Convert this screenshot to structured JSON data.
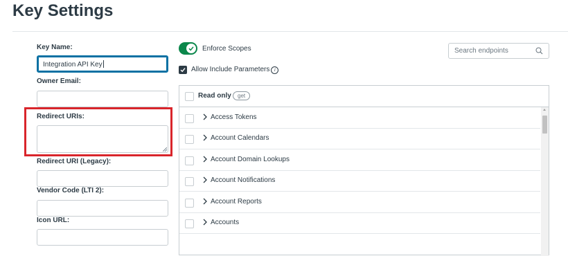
{
  "page_title": "Key Settings",
  "form": {
    "key_name_label": "Key Name:",
    "key_name_value": "Integration API Key",
    "owner_email_label": "Owner Email:",
    "owner_email_value": "",
    "redirect_uris_label": "Redirect URIs:",
    "redirect_uris_value": "",
    "redirect_uri_legacy_label": "Redirect URI (Legacy):",
    "vendor_code_label": "Vendor Code (LTI 2):",
    "icon_url_label": "Icon URL:"
  },
  "scopes": {
    "enforce_label": "Enforce Scopes",
    "enforce_on": true,
    "allow_include_label": "Allow Include Parameters",
    "allow_include_checked": true,
    "search_placeholder": "Search endpoints",
    "read_only_label": "Read only",
    "get_pill": "get",
    "items": [
      {
        "label": "Access Tokens"
      },
      {
        "label": "Account Calendars"
      },
      {
        "label": "Account Domain Lookups"
      },
      {
        "label": "Account Notifications"
      },
      {
        "label": "Account Reports"
      },
      {
        "label": "Accounts"
      }
    ]
  },
  "colors": {
    "toggle_on": "#0b874b",
    "focus_ring": "#0770a3",
    "annotation_box": "#d9252b"
  }
}
